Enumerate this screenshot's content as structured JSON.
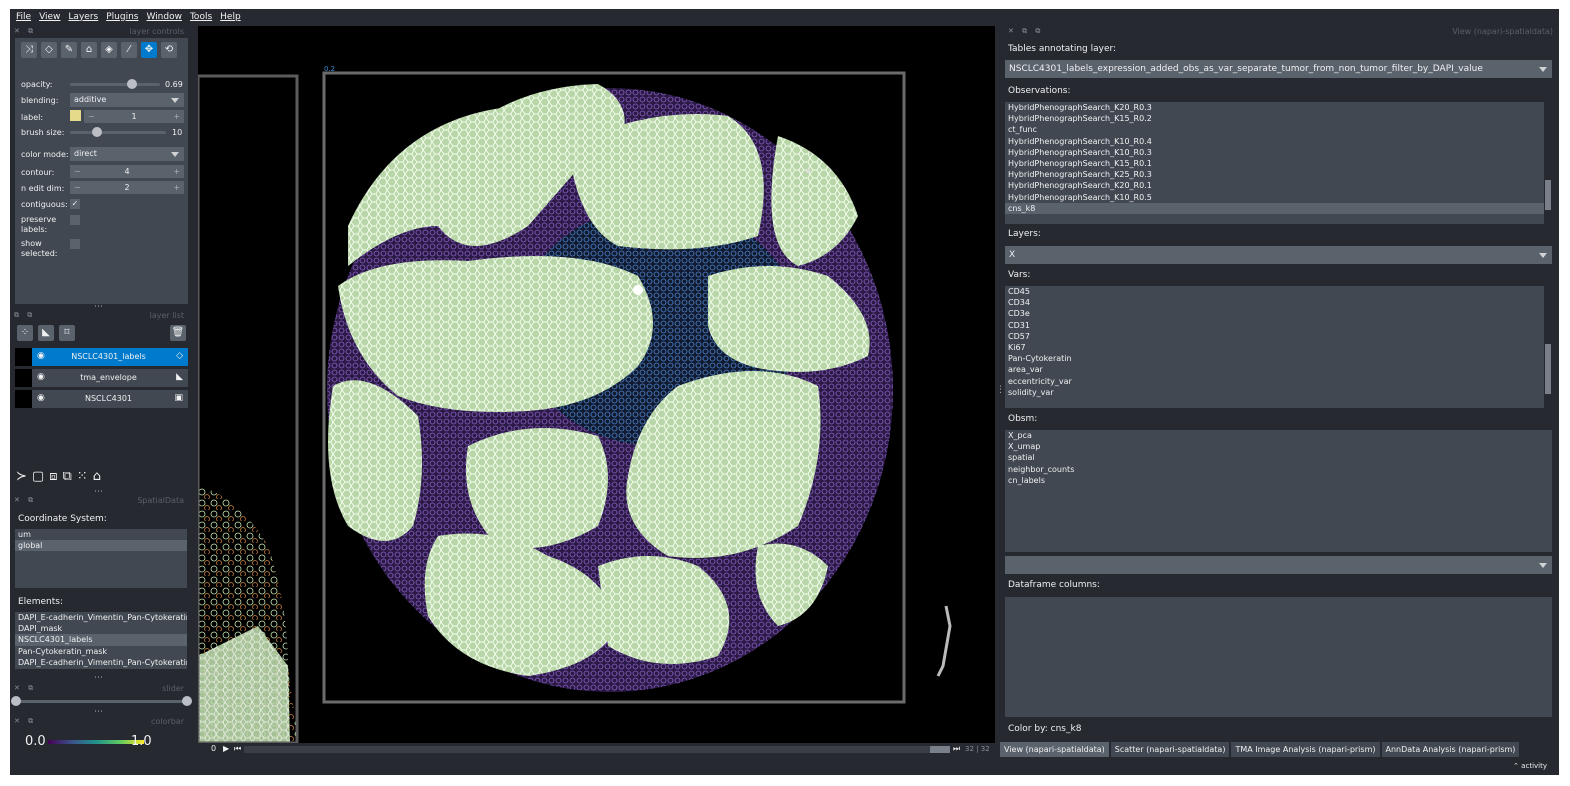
{
  "menu": [
    "File",
    "View",
    "Layers",
    "Plugins",
    "Window",
    "Tools",
    "Help"
  ],
  "layer_controls": {
    "title": "layer controls",
    "opacity_label": "opacity:",
    "opacity_value": "0.69",
    "opacity_level": 0.69,
    "blending_label": "blending:",
    "blending_value": "additive",
    "label_label": "label:",
    "label_value": "1",
    "label_color": "#e5d98a",
    "brush_label": "brush size:",
    "brush_value": "10",
    "brush_level": 0.28,
    "color_mode_label": "color mode:",
    "color_mode_value": "direct",
    "contour_label": "contour:",
    "contour_value": "4",
    "n_edit_label": "n edit dim:",
    "n_edit_value": "2",
    "contiguous_label": "contiguous:",
    "preserve_label": "preserve labels:",
    "show_selected_label": "show selected:"
  },
  "layer_list": {
    "title": "layer list",
    "layers": [
      {
        "name": "NSCLC4301_labels",
        "selected": true,
        "type_icon": "tag-icon"
      },
      {
        "name": "tma_envelope",
        "selected": false,
        "type_icon": "shapes-icon"
      },
      {
        "name": "NSCLC4301",
        "selected": false,
        "type_icon": "image-icon"
      }
    ]
  },
  "spatialdata": {
    "title": "SpatialData",
    "coord_label": "Coordinate System:",
    "coords": [
      "um",
      "global"
    ],
    "coord_selected": 1,
    "elements_label": "Elements:",
    "elements": [
      "DAPI_E-cadherin_Vimentin_Pan-Cytokeratin",
      "DAPI_mask",
      "NSCLC4301_labels",
      "Pan-Cytokeratin_mask",
      "DAPI_E-cadherin_Vimentin_Pan-Cytokeratin"
    ],
    "element_selected": 2
  },
  "slider_title": "slider",
  "colorbar": {
    "title": "colorbar",
    "min": "0.0",
    "max": "1.0"
  },
  "dims": {
    "current": "0",
    "frame": "32",
    "total": "32",
    "position": 1.0
  },
  "right": {
    "title": "View (napari-spatialdata)",
    "tables_label": "Tables annotating layer:",
    "table_value": "NSCLC4301_labels_expression_added_obs_as_var_separate_tumor_from_non_tumor_filter_by_DAPI_value",
    "obs_label": "Observations:",
    "observations": [
      "HybridPhenographSearch_K20_R0.3",
      "HybridPhenographSearch_K15_R0.2",
      "ct_func",
      "HybridPhenographSearch_K10_R0.4",
      "HybridPhenographSearch_K10_R0.3",
      "HybridPhenographSearch_K15_R0.1",
      "HybridPhenographSearch_K25_R0.3",
      "HybridPhenographSearch_K20_R0.1",
      "HybridPhenographSearch_K10_R0.5",
      "cns_k8"
    ],
    "obs_selected": 9,
    "layers_label": "Layers:",
    "layers_value": "X",
    "vars_label": "Vars:",
    "vars": [
      "CD45",
      "CD34",
      "CD3e",
      "CD31",
      "CD57",
      "Ki67",
      "Pan-Cytokeratin",
      "area_var",
      "eccentricity_var",
      "solidity_var"
    ],
    "obsm_label": "Obsm:",
    "obsm": [
      "X_pca",
      "X_umap",
      "spatial",
      "neighbor_counts",
      "cn_labels"
    ],
    "df_label": "Dataframe columns:",
    "color_by": "Color by: cns_k8"
  },
  "bottom_tabs": [
    "View (napari-spatialdata)",
    "Scatter (napari-spatialdata)",
    "TMA Image Analysis (napari-prism)",
    "AnnData Analysis (napari-prism)"
  ],
  "bottom_tab_selected": 0,
  "activity": "⌃ activity",
  "canvas_label": "0.2",
  "colors": {
    "accent": "#007acc",
    "panel": "#414851",
    "background": "#262930",
    "cells": "#d8f0c8",
    "stroma": "#6a4a9a"
  }
}
